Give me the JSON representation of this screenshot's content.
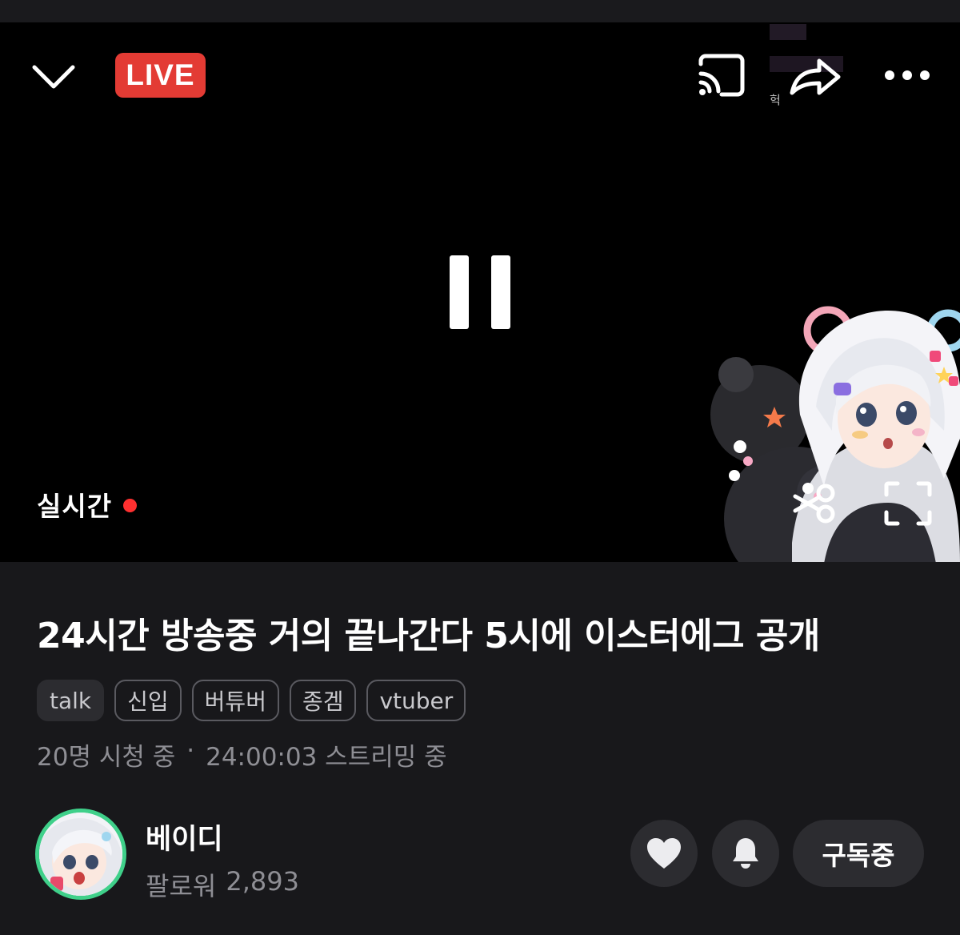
{
  "player": {
    "live_badge": "LIVE",
    "realtime_label": "실시간",
    "overlay_text": "헉"
  },
  "stream": {
    "title": "24시간 방송중 거의 끝나간다 5시에 이스터에그 공개",
    "tags": [
      "talk",
      "신입",
      "버튜버",
      "종겜",
      "vtuber"
    ],
    "viewers": "20명 시청 중",
    "separator": "·",
    "duration": "24:00:03 스트리밍 중"
  },
  "channel": {
    "name": "베이디",
    "followers_label": "팔로워",
    "followers_count": "2,893",
    "subscribe_label": "구독중"
  },
  "colors": {
    "live_red": "#e33b34",
    "avatar_ring": "#3fd08a",
    "background": "#18181b",
    "button_bg": "#2c2c30"
  },
  "icons": [
    "chevron-down-icon",
    "cast-icon",
    "share-icon",
    "more-icon",
    "pause-icon",
    "scissors-icon",
    "fullscreen-icon",
    "heart-icon",
    "bell-icon"
  ]
}
